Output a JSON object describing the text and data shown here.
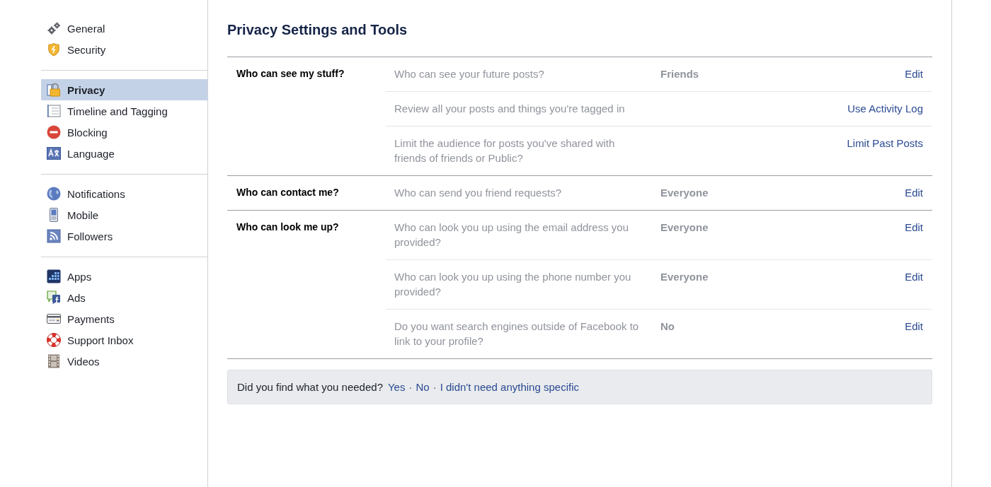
{
  "sidebar": {
    "groups": [
      {
        "items": [
          {
            "label": "General",
            "selected": false
          },
          {
            "label": "Security",
            "selected": false
          }
        ]
      },
      {
        "items": [
          {
            "label": "Privacy",
            "selected": true
          },
          {
            "label": "Timeline and Tagging",
            "selected": false
          },
          {
            "label": "Blocking",
            "selected": false
          },
          {
            "label": "Language",
            "selected": false
          }
        ]
      },
      {
        "items": [
          {
            "label": "Notifications",
            "selected": false
          },
          {
            "label": "Mobile",
            "selected": false
          },
          {
            "label": "Followers",
            "selected": false
          }
        ]
      },
      {
        "items": [
          {
            "label": "Apps",
            "selected": false
          },
          {
            "label": "Ads",
            "selected": false
          },
          {
            "label": "Payments",
            "selected": false
          },
          {
            "label": "Support Inbox",
            "selected": false
          },
          {
            "label": "Videos",
            "selected": false
          }
        ]
      }
    ]
  },
  "page": {
    "title": "Privacy Settings and Tools"
  },
  "sections": [
    {
      "label": "Who can see my stuff?",
      "rows": [
        {
          "question": "Who can see your future posts?",
          "value": "Friends",
          "action": "Edit"
        },
        {
          "question": "Review all your posts and things you're tagged in",
          "action": "Use Activity Log"
        },
        {
          "question": "Limit the audience for posts you've shared with friends of friends or Public?",
          "action": "Limit Past Posts"
        }
      ]
    },
    {
      "label": "Who can contact me?",
      "rows": [
        {
          "question": "Who can send you friend requests?",
          "value": "Everyone",
          "action": "Edit"
        }
      ]
    },
    {
      "label": "Who can look me up?",
      "rows": [
        {
          "question": "Who can look you up using the email address you provided?",
          "value": "Everyone",
          "action": "Edit"
        },
        {
          "question": "Who can look you up using the phone number you provided?",
          "value": "Everyone",
          "action": "Edit"
        },
        {
          "question": "Do you want search engines outside of Facebook to link to your profile?",
          "value": "No",
          "action": "Edit"
        }
      ]
    }
  ],
  "feedback": {
    "prompt": "Did you find what you needed?",
    "items": [
      {
        "kind": "link",
        "text": "Yes"
      },
      {
        "kind": "separator",
        "text": "·"
      },
      {
        "kind": "link",
        "text": "No"
      },
      {
        "kind": "separator",
        "text": "·"
      },
      {
        "kind": "link",
        "text": "I didn't need anything specific"
      }
    ]
  }
}
